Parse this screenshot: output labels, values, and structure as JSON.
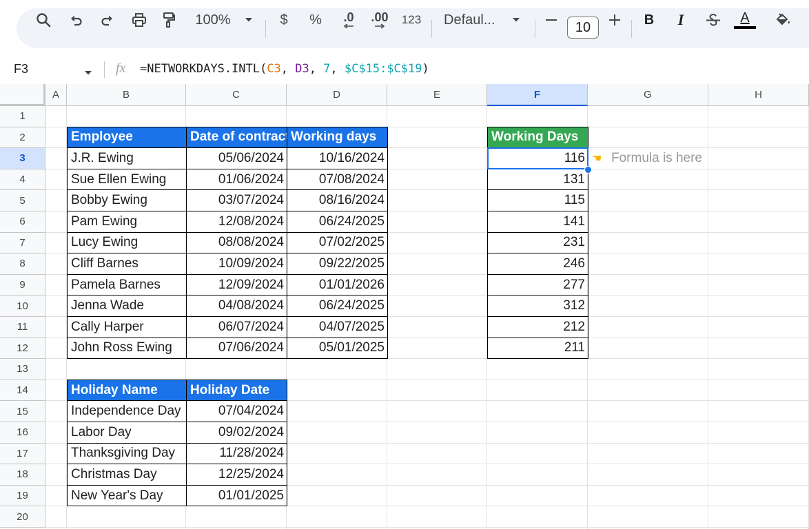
{
  "toolbar": {
    "zoom": "100%",
    "currency": "$",
    "percent": "%",
    "decrease_decimal": ".0",
    "increase_decimal": ".00",
    "number_format": "123",
    "font_name": "Defaul...",
    "font_size": "10",
    "bold": "B",
    "italic": "I",
    "text_color": "A",
    "icons": [
      "search-icon",
      "undo-icon",
      "redo-icon",
      "print-icon",
      "paint-format-icon",
      "dropdown-icon",
      "minus-icon",
      "plus-icon",
      "strikethrough-icon",
      "fill-color-icon"
    ]
  },
  "formula_bar": {
    "cell_ref": "F3",
    "fx": "fx",
    "formula_parts": [
      "=NETWORKDAYS.INTL(",
      "C3",
      ", ",
      "D3",
      ", ",
      "7",
      ", ",
      "$C$15:$C$19",
      ")"
    ]
  },
  "columns": [
    "A",
    "B",
    "C",
    "D",
    "E",
    "F",
    "G",
    "H"
  ],
  "selected_column": "F",
  "rows": [
    "1",
    "2",
    "3",
    "4",
    "5",
    "6",
    "7",
    "8",
    "9",
    "10",
    "11",
    "12",
    "13",
    "14",
    "15",
    "16",
    "17",
    "18",
    "19",
    "20"
  ],
  "selected_row": "3",
  "employees": {
    "headers": [
      "Employee",
      "Date of contract",
      "Working days"
    ],
    "rows": [
      [
        "J.R. Ewing",
        "05/06/2024",
        "10/16/2024"
      ],
      [
        "Sue Ellen Ewing",
        "01/06/2024",
        "07/08/2024"
      ],
      [
        "Bobby Ewing",
        "03/07/2024",
        "08/16/2024"
      ],
      [
        "Pam Ewing",
        "12/08/2024",
        "06/24/2025"
      ],
      [
        "Lucy Ewing",
        "08/08/2024",
        "07/02/2025"
      ],
      [
        "Cliff Barnes",
        "10/09/2024",
        "09/22/2025"
      ],
      [
        "Pamela Barnes",
        "12/09/2024",
        "01/01/2026"
      ],
      [
        "Jenna Wade",
        "04/08/2024",
        "06/24/2025"
      ],
      [
        "Cally Harper",
        "06/07/2024",
        "04/07/2025"
      ],
      [
        "John Ross Ewing",
        "07/06/2024",
        "05/01/2025"
      ]
    ]
  },
  "working_days": {
    "header": "Working Days",
    "values": [
      "116",
      "131",
      "115",
      "141",
      "231",
      "246",
      "277",
      "312",
      "212",
      "211"
    ]
  },
  "note": {
    "icon": "pointing-hand-icon",
    "text": "Formula is here"
  },
  "holidays": {
    "headers": [
      "Holiday Name",
      "Holiday Date"
    ],
    "rows": [
      [
        "Independence Day",
        "07/04/2024"
      ],
      [
        "Labor Day",
        "09/02/2024"
      ],
      [
        "Thanksgiving Day",
        "11/28/2024"
      ],
      [
        "Christmas Day",
        "12/25/2024"
      ],
      [
        "New Year's Day",
        "01/01/2025"
      ]
    ]
  },
  "colors": {
    "header_blue": "#1a73e8",
    "header_green": "#34a853",
    "selection_blue": "#1a73e8"
  }
}
